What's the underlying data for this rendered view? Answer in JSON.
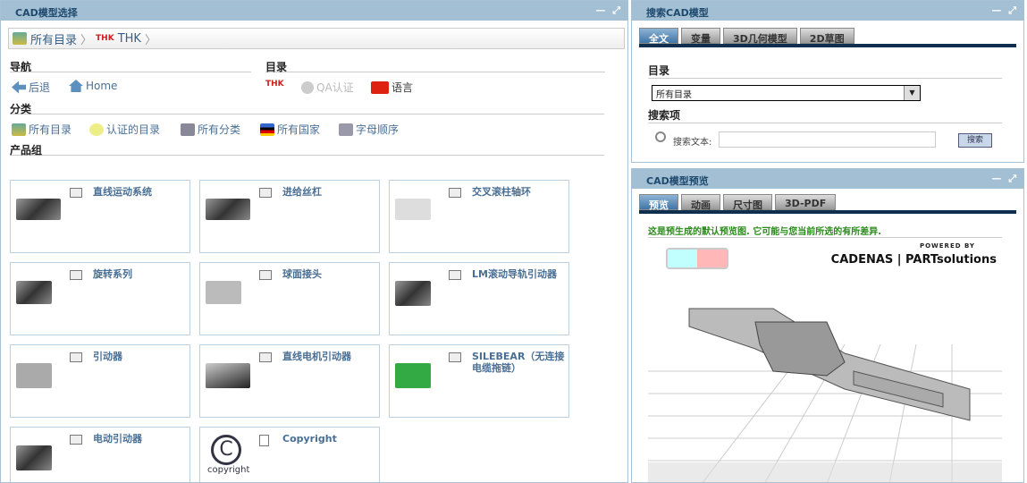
{
  "left_panel": {
    "title": "CAD模型选择",
    "window_controls": "— ⤢",
    "breadcrumb": [
      {
        "label": "所有目录"
      },
      {
        "label": "THK"
      }
    ],
    "nav_heading": "导航",
    "catalog_heading": "目录",
    "category_heading": "分类",
    "product_heading": "产品组",
    "nav": {
      "back": "后退",
      "home": "Home"
    },
    "catalog": {
      "logo": "THK",
      "qa": "QA认证",
      "language": "语言"
    },
    "categories": [
      "所有目录",
      "认证的目录",
      "所有分类",
      "所有国家",
      "字母顺序"
    ],
    "products": [
      "直线运动系统",
      "进给丝杠",
      "交叉滚柱轴环",
      "旋转系列",
      "球面接头",
      "LM滚动导轨引动器",
      "引动器",
      "直线电机引动器",
      "SILEBEAR（无连接电缆拖链）",
      "电动引动器",
      "Copyright"
    ],
    "copyright_caption": "copyright"
  },
  "search_panel": {
    "title": "搜索CAD模型",
    "tabs": [
      "全文",
      "变量",
      "3D几何模型",
      "2D草图"
    ],
    "catalog_label": "目录",
    "catalog_value": "所有目录",
    "search_heading": "搜索项",
    "search_text_label": "搜索文本:",
    "search_value": "",
    "search_button": "搜索"
  },
  "preview_panel": {
    "title": "CAD模型预览",
    "tabs": [
      "预览",
      "动画",
      "尺寸图",
      "3D-PDF"
    ],
    "notice": "这是预生成的默认预览图. 它可能与您当前所选的有所差异.",
    "powered_by": "POWERED BY",
    "brand": "CADENAS | PARTsolutions"
  },
  "colors": {
    "header": "#a2bfd4",
    "accent": "#0e2f4e",
    "notice": "#2a8a1a"
  }
}
